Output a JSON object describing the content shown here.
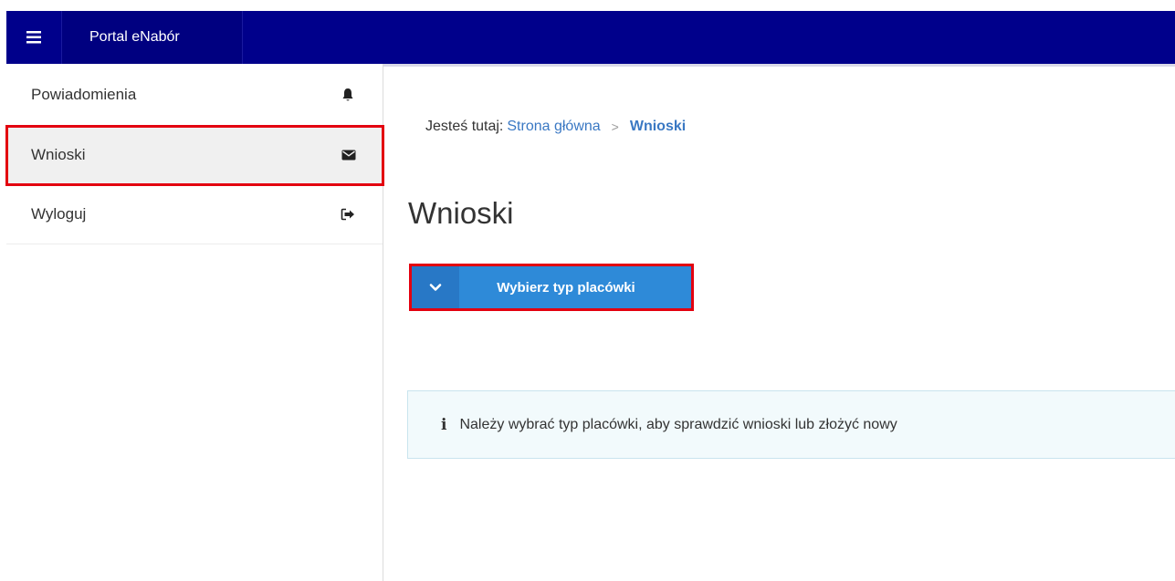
{
  "header": {
    "app_title": "Portal eNabór"
  },
  "sidebar": {
    "items": [
      {
        "label": "Powiadomienia",
        "icon": "bell-icon"
      },
      {
        "label": "Wnioski",
        "icon": "envelope-icon"
      },
      {
        "label": "Wyloguj",
        "icon": "sign-out-icon"
      }
    ]
  },
  "breadcrumb": {
    "prefix": "Jesteś tutaj:",
    "home": "Strona główna",
    "separator": ">",
    "current": "Wnioski"
  },
  "main": {
    "title": "Wnioski",
    "select_button_label": "Wybierz typ placówki",
    "info_message": "Należy wybrać typ placówki, aby sprawdzić wnioski lub złożyć nowy"
  },
  "colors": {
    "header_bg": "#00008b",
    "accent_blue": "#2e8ad8",
    "highlight_red": "#e3000f",
    "link_blue": "#3a78c3"
  }
}
